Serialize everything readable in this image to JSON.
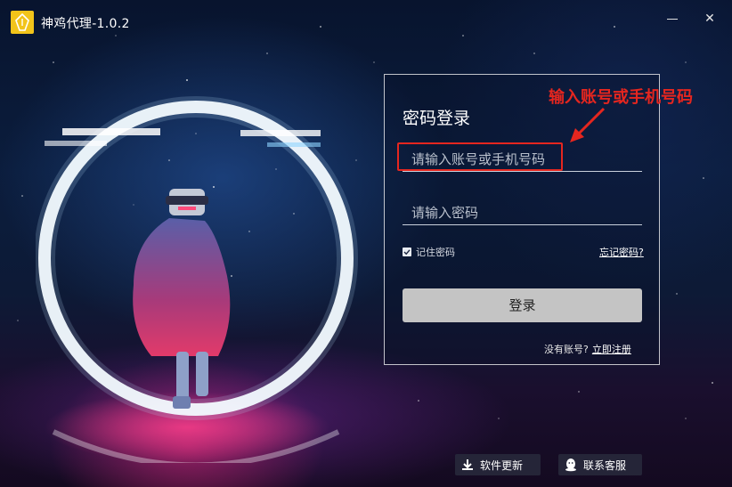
{
  "window": {
    "title": "神鸡代理-1.0.2",
    "minimize_glyph": "–",
    "close_glyph": "✕"
  },
  "login": {
    "heading": "密码登录",
    "account_placeholder": "请输入账号或手机号码",
    "password_placeholder": "请输入密码",
    "remember_label": "记住密码",
    "remember_checked": true,
    "forgot_label": "忘记密码?",
    "submit_label": "登录",
    "no_account_text": "没有账号?",
    "register_label": "立即注册"
  },
  "annotation": {
    "text": "输入账号或手机号码",
    "color": "#e5261f"
  },
  "footer": {
    "update_label": "软件更新",
    "update_icon": "download-icon",
    "service_label": "联系客服",
    "service_icon": "qq-icon"
  },
  "colors": {
    "logo": "#f2c41a",
    "button": "#c4c4c4",
    "annotation": "#e5261f"
  }
}
